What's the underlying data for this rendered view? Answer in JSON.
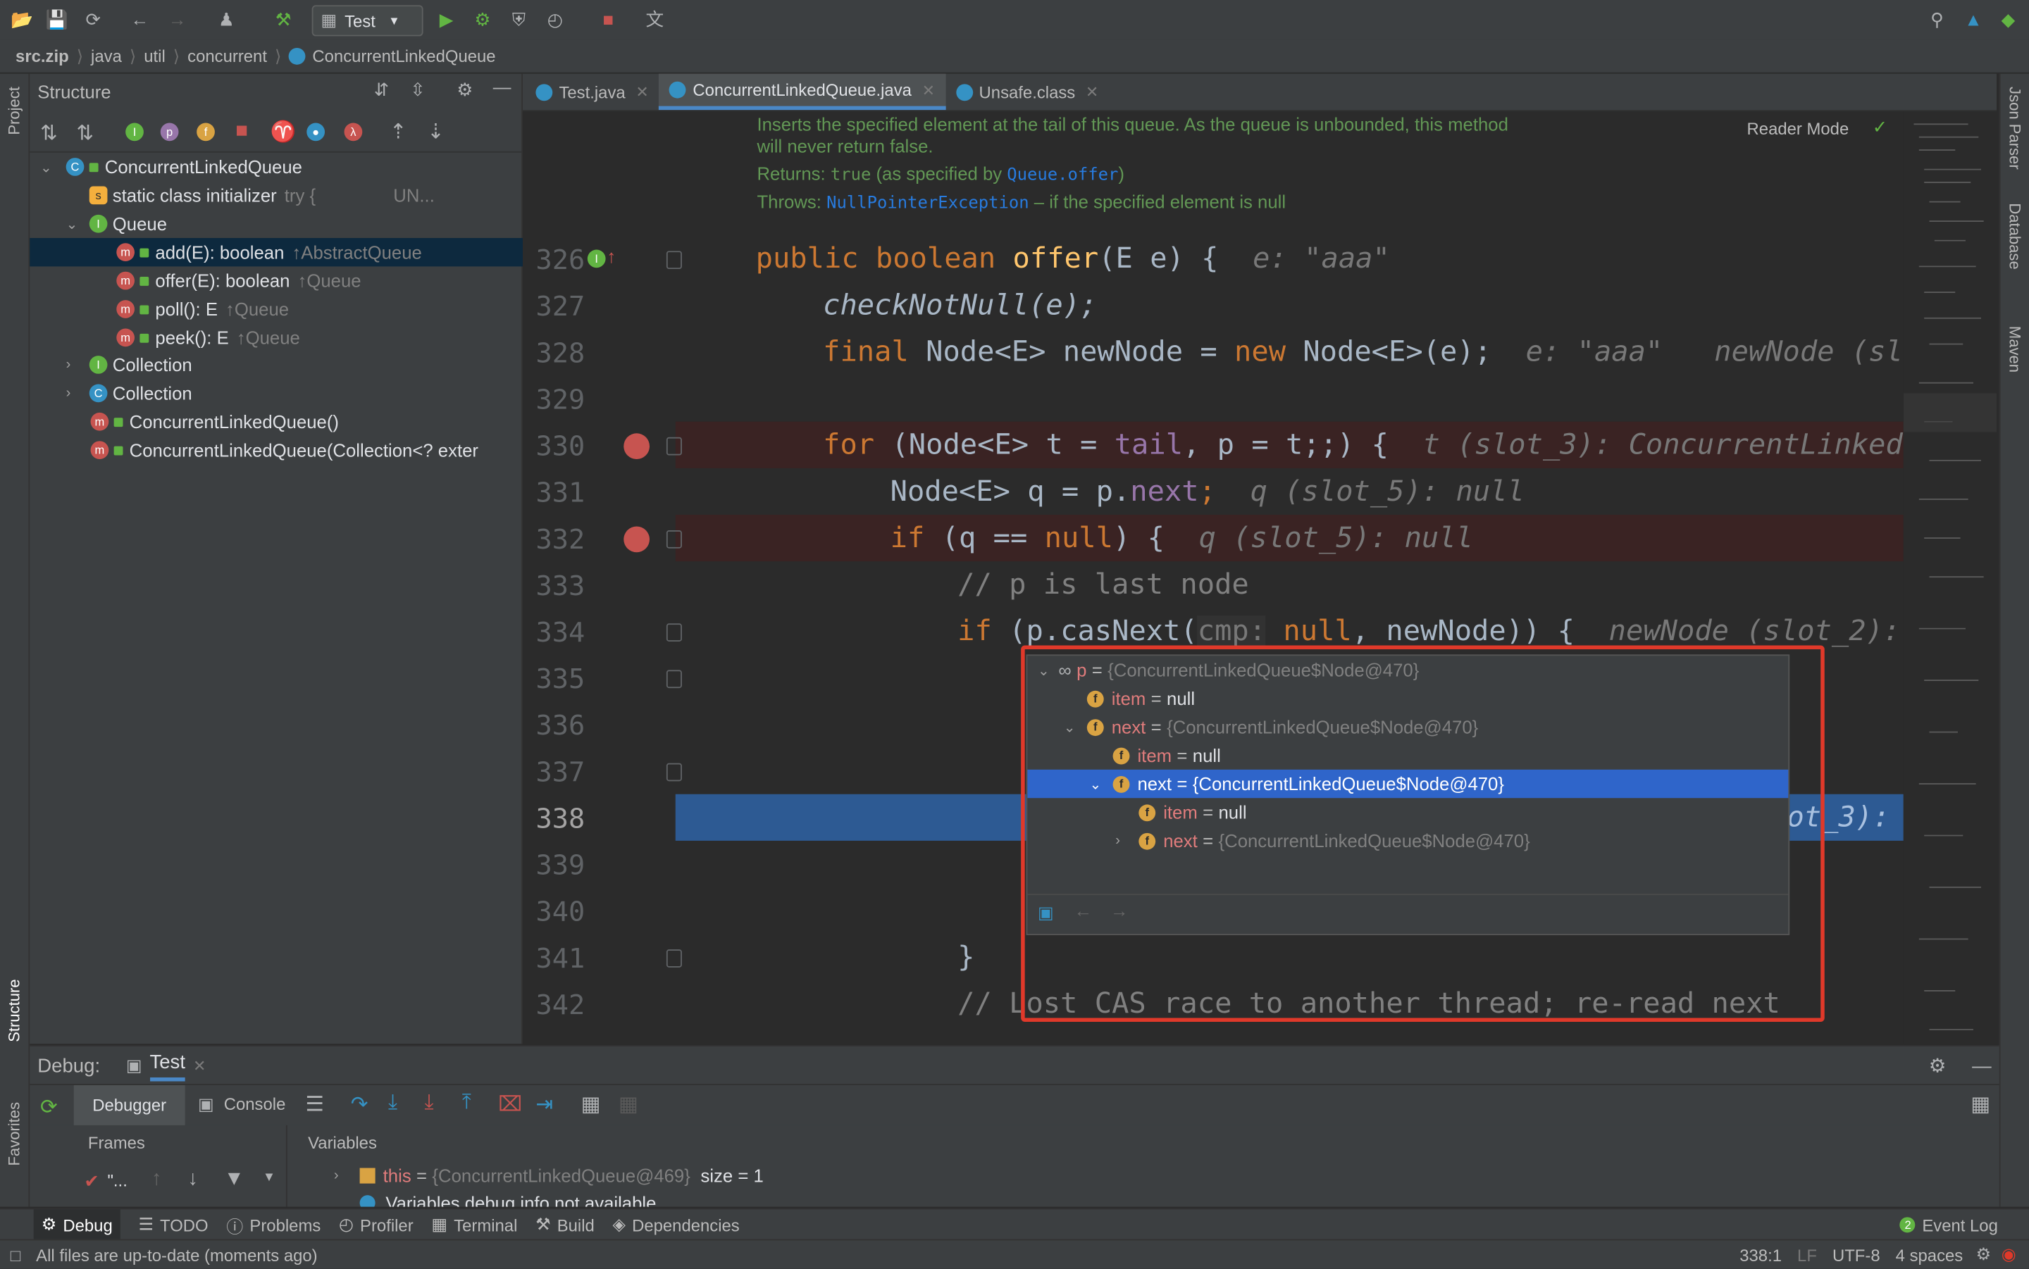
{
  "toolbar": {
    "run_config": "Test",
    "icons": [
      "open-icon",
      "save-icon",
      "sync-icon",
      "back-icon",
      "forward-icon",
      "user-icon",
      "build-icon",
      "run-icon",
      "debug-icon",
      "coverage-icon",
      "profile-icon",
      "stop-icon",
      "translate-icon",
      "search-icon",
      "update-icon",
      "toolbox-icon"
    ]
  },
  "breadcrumb": [
    "src.zip",
    "java",
    "util",
    "concurrent",
    "ConcurrentLinkedQueue"
  ],
  "left_stripe": {
    "project": "Project",
    "structure": "Structure",
    "favorites": "Favorites"
  },
  "structure": {
    "title": "Structure",
    "tree": [
      {
        "name": "ConcurrentLinkedQueue",
        "extra": "",
        "icon": "C"
      },
      {
        "name": "static class initializer",
        "extra": "try {",
        "extra2": "UN...",
        "icon": "s"
      },
      {
        "name": "Queue",
        "extra": "",
        "icon": "I"
      },
      {
        "name": "add(E): boolean",
        "extra": "↑AbstractQueue",
        "icon": "m"
      },
      {
        "name": "offer(E): boolean",
        "extra": "↑Queue",
        "icon": "m"
      },
      {
        "name": "poll(): E",
        "extra": "↑Queue",
        "icon": "m"
      },
      {
        "name": "peek(): E",
        "extra": "↑Queue",
        "icon": "m"
      },
      {
        "name": "Collection",
        "extra": "",
        "icon": "I"
      },
      {
        "name": "Collection",
        "extra": "",
        "icon": "I"
      },
      {
        "name": "ConcurrentLinkedQueue()",
        "extra": "",
        "icon": "m"
      },
      {
        "name": "ConcurrentLinkedQueue(Collection<? exter",
        "extra": "",
        "icon": "m"
      }
    ]
  },
  "tabs": [
    {
      "label": "Test.java",
      "active": false
    },
    {
      "label": "ConcurrentLinkedQueue.java",
      "active": true
    },
    {
      "label": "Unsafe.class",
      "active": false
    }
  ],
  "reader_mode": "Reader Mode",
  "doc": {
    "line1": "Inserts the specified element at the tail of this queue. As the queue is unbounded, this method",
    "line2": "will never return false.",
    "returns_label": "Returns:",
    "returns_true": "true",
    "returns_mid": "(as specified by",
    "returns_link": "Queue.offer",
    "returns_end": ")",
    "throws_label": "Throws:",
    "throws_link": "NullPointerException",
    "throws_end": "– if the specified element is null"
  },
  "code": {
    "line_numbers": [
      "326",
      "327",
      "328",
      "329",
      "330",
      "331",
      "332",
      "333",
      "334",
      "335",
      "336",
      "337",
      "338",
      "339",
      "340",
      "341",
      "342"
    ],
    "l326_a": "public boolean ",
    "l326_fn": "offer",
    "l326_b": "(E e) {",
    "l326_hint": "e: \"aaa\"",
    "l327": "checkNotNull(e);",
    "l328_a": "final ",
    "l328_b": "Node<E> newNode = ",
    "l328_c": "new ",
    "l328_d": "Node<E>(e);",
    "l328_hint": "e: \"aaa\"   newNode (sl",
    "l330_a": "for ",
    "l330_b": "(Node<E> t = ",
    "l330_c": "tail",
    "l330_d": ", p = t;;) {",
    "l330_hint": "t (slot_3): ConcurrentLinked",
    "l331_a": "Node<E> q = p.",
    "l331_b": "next",
    "l331_c": ";",
    "l331_hint": "q (slot_5): null",
    "l332_a": "if ",
    "l332_b": "(q == ",
    "l332_c": "null",
    "l332_d": ") {",
    "l332_hint": "q (slot_5): null",
    "l333": "// p is last node",
    "l334_a": "if ",
    "l334_b": "(p.casNext(",
    "l334_param": "cmp:",
    "l334_c": " null",
    "l334_d": ", newNode)) {",
    "l334_hint": "newNode (slot_2):",
    "l338_hint": "ot_3):",
    "l341": "}",
    "l342": "// Lost CAS race to another thread; re-read next"
  },
  "popup": {
    "rows": [
      {
        "name": "p",
        "value": "{ConcurrentLinkedQueue$Node@470}",
        "kind": "watch"
      },
      {
        "name": "item",
        "value": "null",
        "kind": "field"
      },
      {
        "name": "next",
        "value": "{ConcurrentLinkedQueue$Node@470}",
        "kind": "field"
      },
      {
        "name": "item",
        "value": "null",
        "kind": "field"
      },
      {
        "name": "next",
        "value": "{ConcurrentLinkedQueue$Node@470}",
        "kind": "field"
      },
      {
        "name": "item",
        "value": "null",
        "kind": "field"
      },
      {
        "name": "next",
        "value": "{ConcurrentLinkedQueue$Node@470}",
        "kind": "field"
      }
    ],
    "eq": "="
  },
  "debug": {
    "label": "Debug:",
    "session": "Test",
    "tab_debugger": "Debugger",
    "tab_console": "Console",
    "frames_label": "Frames",
    "variables_label": "Variables",
    "frame_item": "\"...",
    "var_name": "this",
    "var_value": "{ConcurrentLinkedQueue@469}",
    "var_size": "size = 1",
    "var_info": "Variables debug info not available"
  },
  "bottom_tabs": [
    "Debug",
    "TODO",
    "Problems",
    "Profiler",
    "Terminal",
    "Build",
    "Dependencies"
  ],
  "event_log": "Event Log",
  "event_count": "2",
  "status": {
    "message": "All files are up-to-date (moments ago)",
    "position": "338:1",
    "line_sep": "LF",
    "encoding": "UTF-8",
    "indent": "4 spaces"
  },
  "right_stripe": [
    "Json Parser",
    "Database",
    "Maven"
  ],
  "colors": {
    "accent": "#2f65ca",
    "breakpoint": "#c75450",
    "exec_line": "#2d5a93",
    "highlight_frame": "#e0392a"
  }
}
